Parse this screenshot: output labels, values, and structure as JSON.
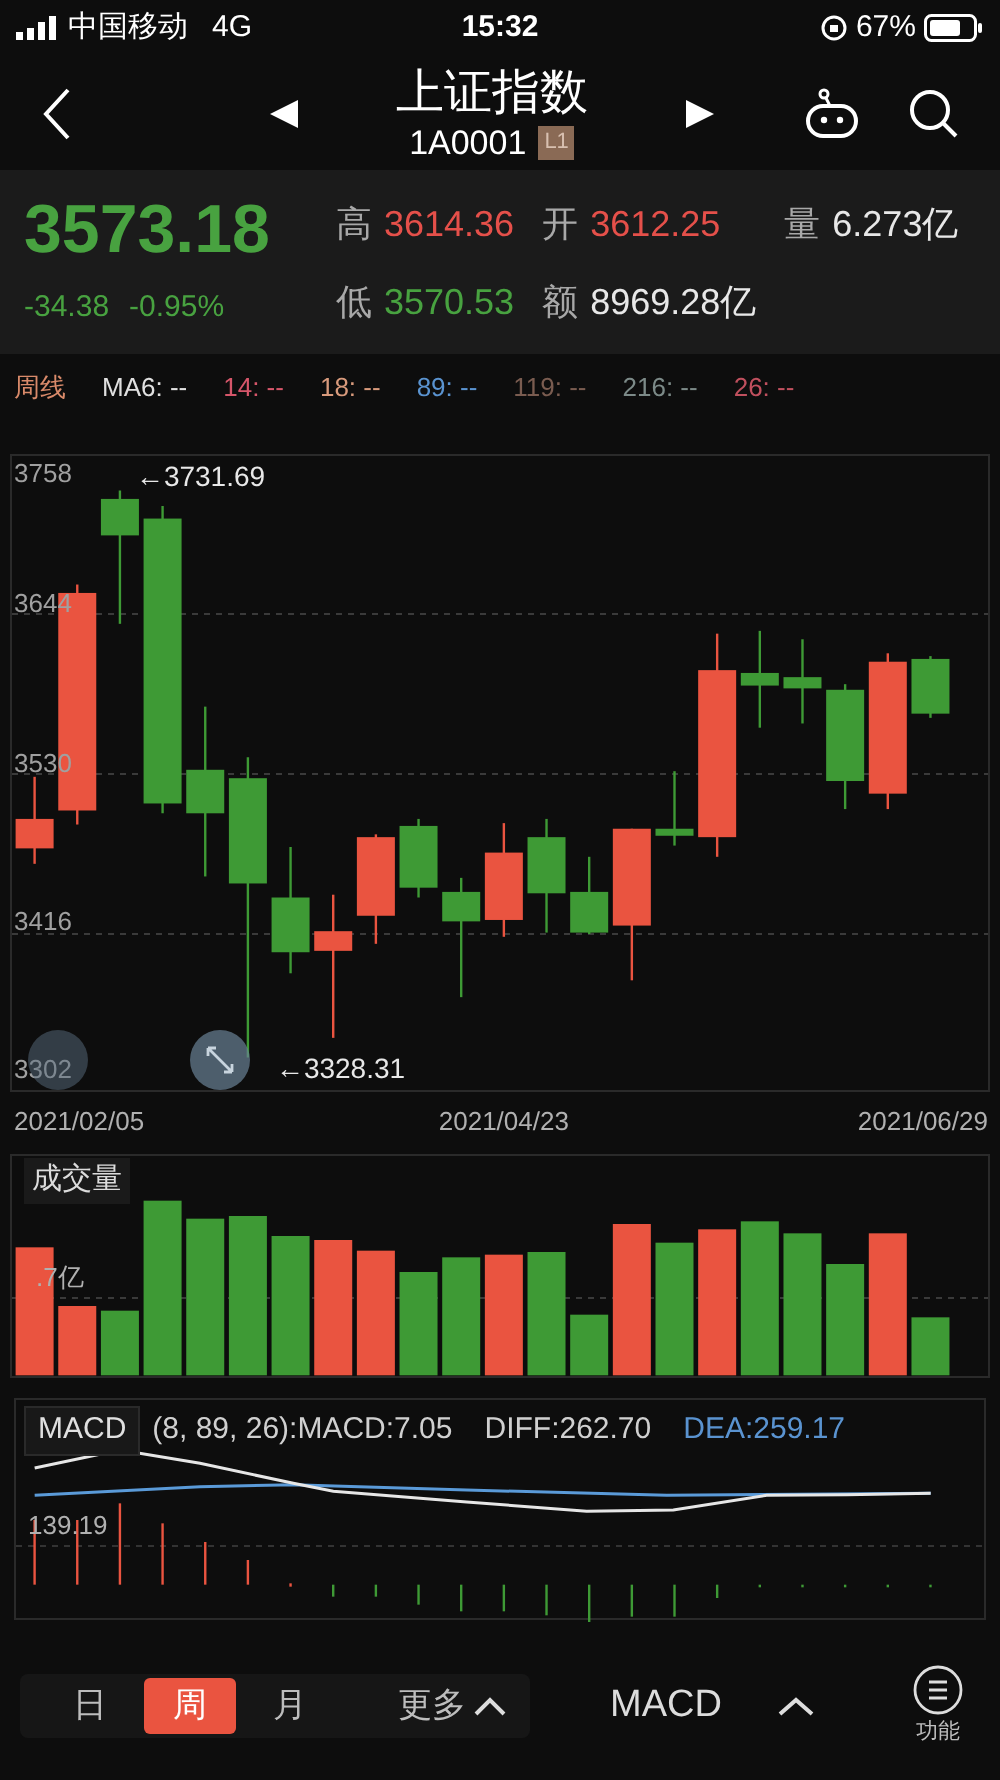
{
  "status_bar": {
    "carrier": "中国移动",
    "network": "4G",
    "time": "15:32",
    "battery": "67%"
  },
  "header": {
    "title": "上证指数",
    "code": "1A0001",
    "level_badge": "L1"
  },
  "quote": {
    "price": "3573.18",
    "change": "-34.38",
    "change_pct": "-0.95%",
    "stats": [
      {
        "label": "高",
        "value": "3614.36",
        "color": "#e5504a"
      },
      {
        "label": "开",
        "value": "3612.25",
        "color": "#e5504a"
      },
      {
        "label": "量",
        "value": "6.273亿",
        "color": "#e8e8e8"
      },
      {
        "label": "低",
        "value": "3570.53",
        "color": "#48a240"
      },
      {
        "label": "额",
        "value": "8969.28亿",
        "color": "#e8e8e8"
      }
    ]
  },
  "ma_legend": {
    "period_label": "周线",
    "items": [
      {
        "label": "MA6: --",
        "color": "#e0e0e0"
      },
      {
        "label": "14: --",
        "color": "#d6566a"
      },
      {
        "label": "18: --",
        "color": "#d89a7c"
      },
      {
        "label": "89: --",
        "color": "#5a93d0"
      },
      {
        "label": "119: --",
        "color": "#7a5c50"
      },
      {
        "label": "216: --",
        "color": "#7c8a88"
      },
      {
        "label": "26: --",
        "color": "#c0505e"
      }
    ]
  },
  "kline": {
    "axis_labels": [
      "3758",
      "3644",
      "3530",
      "3416",
      "3302"
    ],
    "date_labels": [
      "2021/02/05",
      "2021/04/23",
      "2021/06/29"
    ],
    "annotations": [
      "←3731.69",
      "←3328.31"
    ]
  },
  "volume": {
    "title": "成交量",
    "axis_label": ".7亿"
  },
  "macd": {
    "title": "MACD",
    "params": "(8, 89, 26):MACD:7.05",
    "diff": "DIFF:262.70",
    "dea": "DEA:259.17",
    "axis_label": "139.19"
  },
  "bottom_bar": {
    "periods": [
      {
        "label": "日",
        "selected": false
      },
      {
        "label": "周",
        "selected": true
      },
      {
        "label": "月",
        "selected": false
      }
    ],
    "more": "更多",
    "indicator": "MACD",
    "menu_label": "功能"
  }
}
